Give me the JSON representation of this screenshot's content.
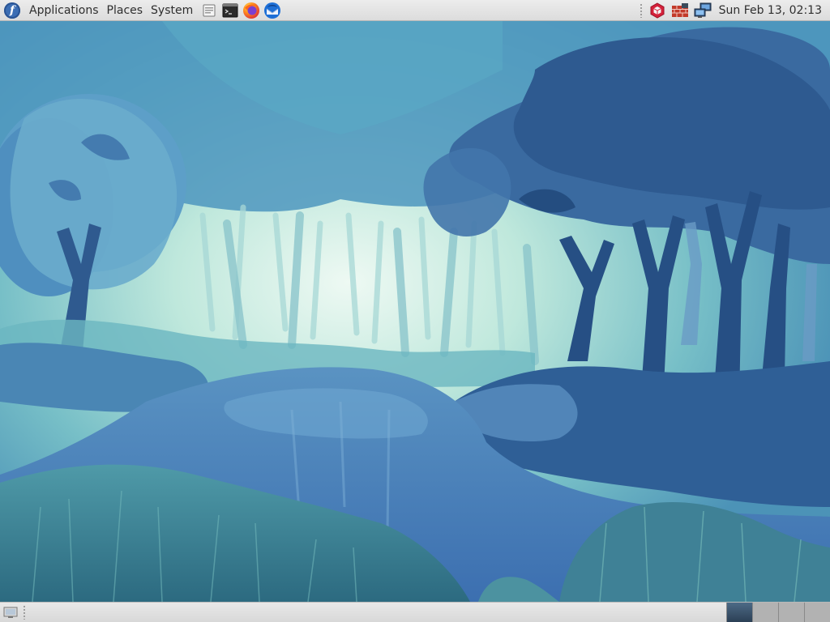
{
  "top_panel": {
    "logo_icon": "fedora-logo-icon",
    "logo_glyph": "f",
    "menus": [
      {
        "label": "Applications"
      },
      {
        "label": "Places"
      },
      {
        "label": "System"
      }
    ],
    "launchers": [
      {
        "name": "file-manager-icon"
      },
      {
        "name": "terminal-icon"
      },
      {
        "name": "firefox-icon"
      },
      {
        "name": "thunderbird-icon"
      }
    ],
    "tray": [
      {
        "name": "package-update-icon"
      },
      {
        "name": "firewall-icon"
      },
      {
        "name": "network-icon"
      }
    ],
    "clock": "Sun Feb 13, 02:13"
  },
  "bottom_panel": {
    "show_desktop_icon": "show-desktop-icon",
    "workspaces": [
      {
        "active": true
      },
      {
        "active": false
      },
      {
        "active": false
      },
      {
        "active": false
      }
    ]
  },
  "colors": {
    "panel_bg": "#e0e0e0",
    "fedora_blue": "#3c6eb4",
    "wallpaper_sky": "#bfe8e0",
    "wallpaper_trees": "#2f5a8f"
  }
}
